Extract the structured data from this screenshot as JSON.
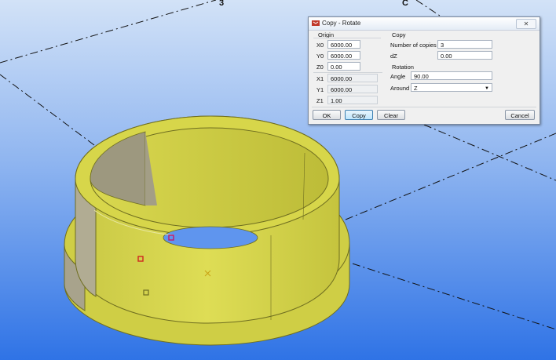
{
  "grid_labels": {
    "top_a": "3",
    "top_b": "C"
  },
  "dialog": {
    "title": "Copy - Rotate",
    "close_glyph": "✕",
    "origin": {
      "heading": "Origin",
      "x0_label": "X0",
      "x0_value": "6000.00",
      "y0_label": "Y0",
      "y0_value": "6000.00",
      "z0_label": "Z0",
      "z0_value": "0.00",
      "x1_label": "X1",
      "x1_value": "6000.00",
      "y1_label": "Y1",
      "y1_value": "6000.00",
      "z1_label": "Z1",
      "z1_value": "1.00"
    },
    "copy": {
      "heading": "Copy",
      "copies_label": "Number of copies",
      "copies_value": "3",
      "dz_label": "dZ",
      "dz_value": "0.00"
    },
    "rotation": {
      "heading": "Rotation",
      "angle_label": "Angle",
      "angle_value": "90.00",
      "around_label": "Around",
      "around_value": "Z"
    },
    "buttons": {
      "ok": "OK",
      "copy": "Copy",
      "clear": "Clear",
      "cancel": "Cancel"
    }
  },
  "colors": {
    "background_top": "#cfe0f7",
    "background_bottom": "#2f73e6",
    "part_yellow": "#d7d64a",
    "part_gray": "#a8a38c",
    "accent_focus": "#3c7fb1"
  }
}
